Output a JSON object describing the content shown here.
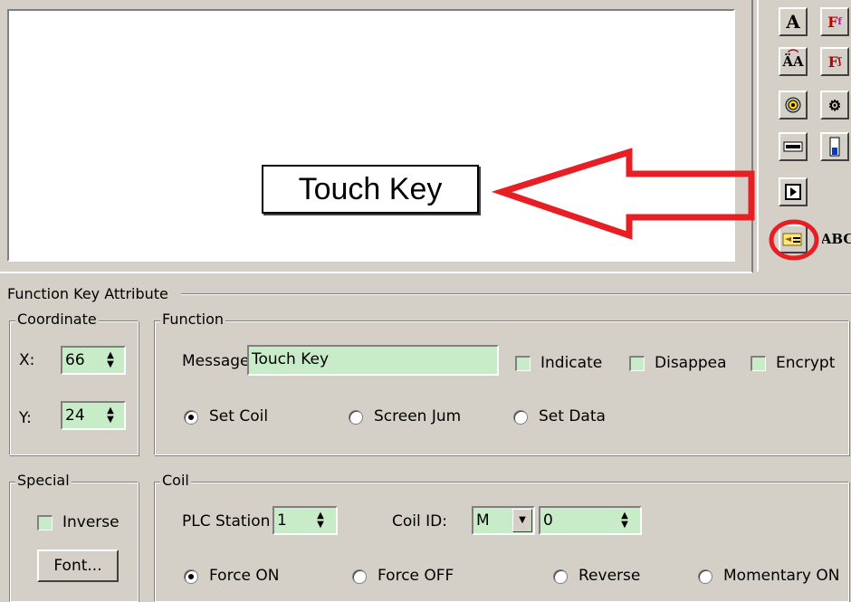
{
  "preview": {
    "touch_key_label": "Touch Key"
  },
  "toolbar": {
    "buttons": [
      "text-icon",
      "font-f-icon",
      "text-rotate-icon",
      "font-f2-icon",
      "target-icon",
      "gears-icon",
      "keyboard-icon",
      "meter-icon",
      "play-icon",
      "touch-key-icon"
    ],
    "abc_label": "ABC",
    "highlight_color": "#e81e25"
  },
  "panel": {
    "title": "Function Key Attribute",
    "coordinate": {
      "title": "Coordinate",
      "x_label": "X:",
      "x_value": "66",
      "y_label": "Y:",
      "y_value": "24"
    },
    "function": {
      "title": "Function",
      "message_label": "Message",
      "message_value": "Touch Key",
      "indicate_label": "Indicate",
      "disappear_label": "Disappea",
      "encrypt_label": "Encrypt",
      "set_coil_label": "Set Coil",
      "screen_jump_label": "Screen Jum",
      "set_data_label": "Set Data"
    },
    "special": {
      "title": "Special",
      "inverse_label": "Inverse",
      "font_button": "Font..."
    },
    "coil": {
      "title": "Coil",
      "plc_station_label": "PLC Station",
      "plc_station_value": "1",
      "coil_id_label": "Coil ID:",
      "coil_type_value": "M",
      "coil_number_value": "0",
      "force_on_label": "Force ON",
      "force_off_label": "Force OFF",
      "reverse_label": "Reverse",
      "momentary_on_label": "Momentary ON"
    }
  }
}
